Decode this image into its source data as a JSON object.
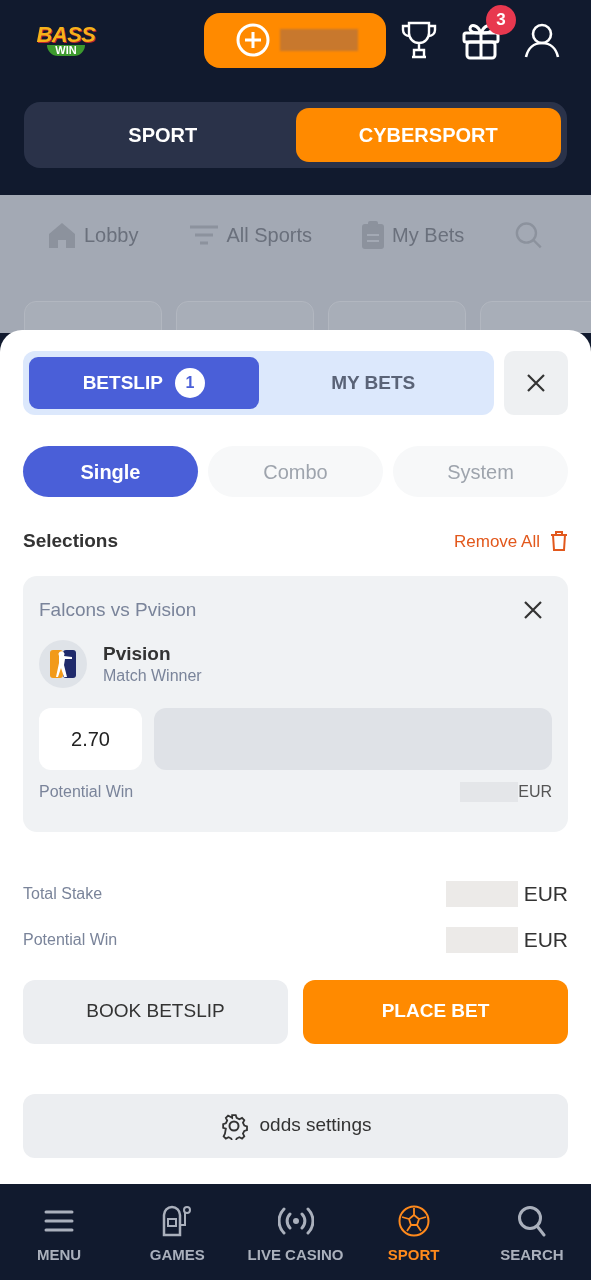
{
  "header": {
    "logo": {
      "line1": "BASS",
      "line2": "WIN"
    },
    "gift_badge": "3"
  },
  "mode_tabs": [
    {
      "label": "SPORT",
      "selected": false
    },
    {
      "label": "CYBERSPORT",
      "selected": true
    }
  ],
  "background_nav": [
    {
      "label": "Lobby",
      "kind": "home"
    },
    {
      "label": "All Sports",
      "kind": "filter"
    },
    {
      "label": "My Bets",
      "kind": "clipboard"
    }
  ],
  "betslip": {
    "tabs": [
      {
        "label": "BETSLIP",
        "badge": "1",
        "selected": true
      },
      {
        "label": "MY BETS",
        "selected": false
      }
    ],
    "bet_types": [
      {
        "label": "Single",
        "selected": true
      },
      {
        "label": "Combo",
        "selected": false
      },
      {
        "label": "System",
        "selected": false
      }
    ],
    "selections_title": "Selections",
    "remove_all": "Remove All",
    "selection": {
      "event": "Falcons vs Pvision",
      "team": "Pvision",
      "market": "Match Winner",
      "odds": "2.70",
      "potential_win_label": "Potential Win",
      "currency": "EUR"
    },
    "totals": [
      {
        "label": "Total Stake",
        "currency": "EUR"
      },
      {
        "label": "Potential Win",
        "currency": "EUR"
      }
    ],
    "buttons": [
      {
        "label": "BOOK BETSLIP",
        "kind": "secondary"
      },
      {
        "label": "PLACE BET",
        "kind": "primary"
      }
    ],
    "odds_settings": "odds settings"
  },
  "bottom_nav": [
    {
      "label": "MENU",
      "kind": "menu",
      "selected": false
    },
    {
      "label": "GAMES",
      "kind": "slot",
      "selected": false
    },
    {
      "label": "LIVE CASINO",
      "kind": "live",
      "selected": false
    },
    {
      "label": "SPORT",
      "kind": "ball",
      "selected": true
    },
    {
      "label": "SEARCH",
      "kind": "search",
      "selected": false
    }
  ]
}
